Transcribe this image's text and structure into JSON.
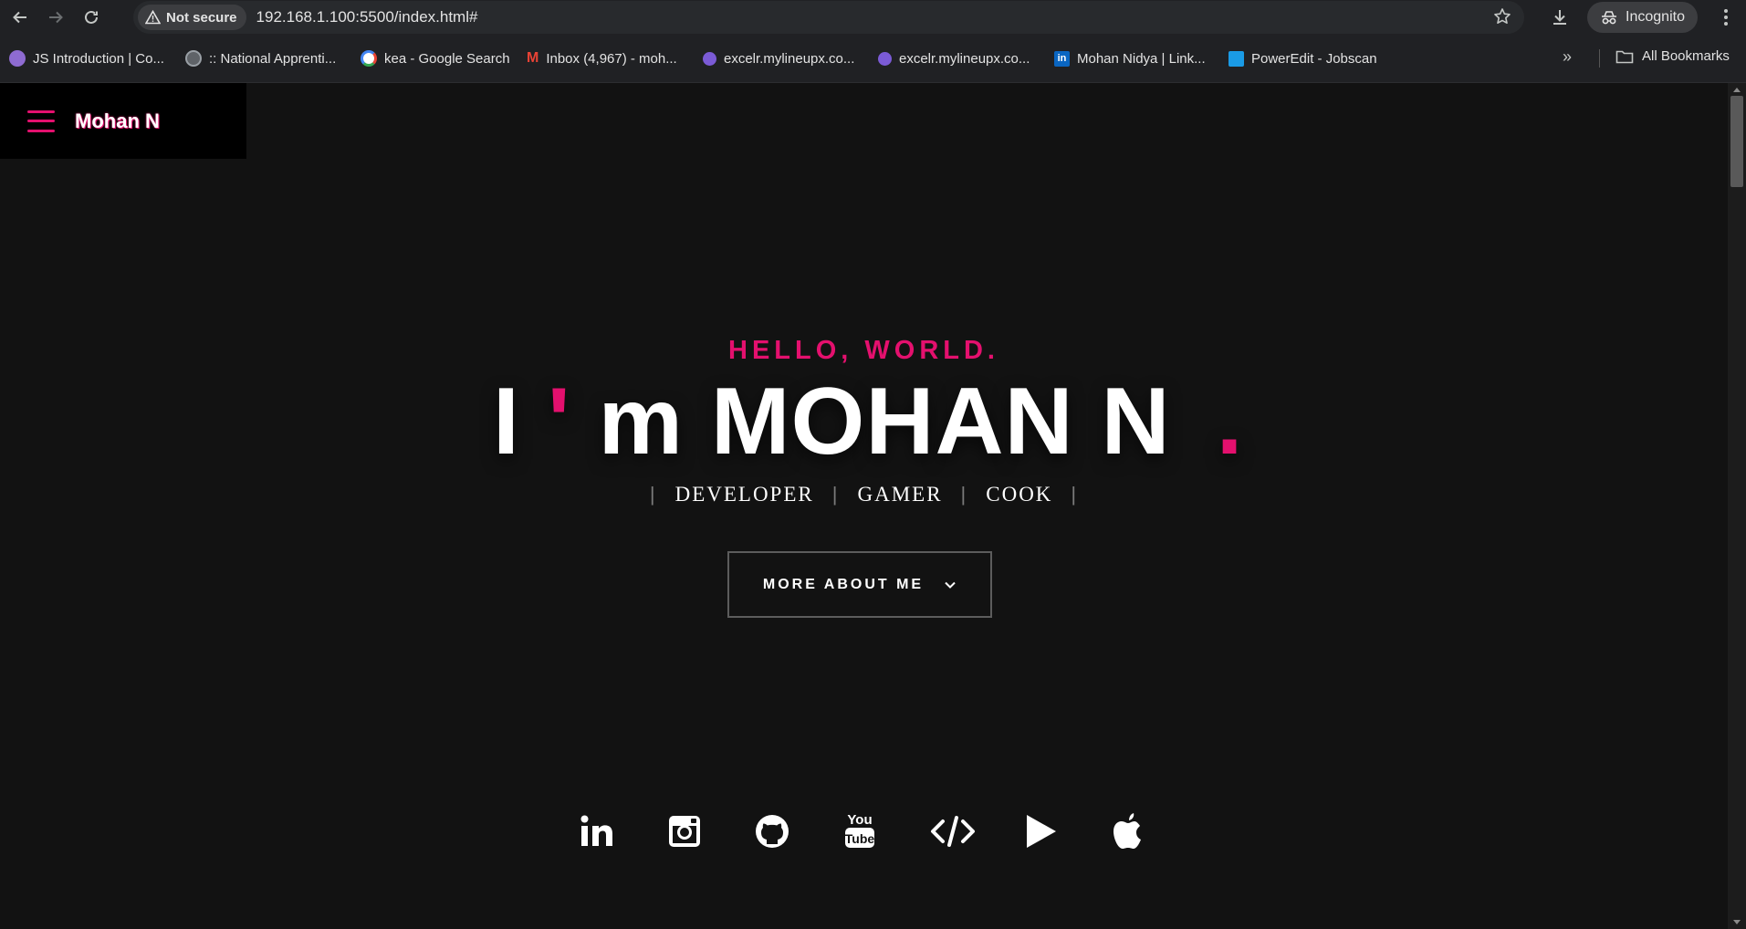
{
  "browser": {
    "security_label": "Not secure",
    "url": "192.168.1.100:5500/index.html#",
    "profile_label": "Incognito",
    "all_bookmarks_label": "All Bookmarks",
    "bookmarks": [
      {
        "label": "JS Introduction | Co...",
        "icon_color": "#8e6bd1"
      },
      {
        "label": ":: National Apprenti...",
        "icon_color": "#9aa0a6"
      },
      {
        "label": "kea - Google Search",
        "icon_color": "#4285f4"
      },
      {
        "label": "Inbox (4,967) - moh...",
        "icon_color": "#ea4335"
      },
      {
        "label": "excelr.mylineupx.co...",
        "icon_color": "#7b5bd6"
      },
      {
        "label": "excelr.mylineupx.co...",
        "icon_color": "#7b5bd6"
      },
      {
        "label": "Mohan Nidya | Link...",
        "icon_color": "#0a66c2"
      },
      {
        "label": "PowerEdit - Jobscan",
        "icon_color": "#1a9be6"
      }
    ]
  },
  "page": {
    "brand": "Mohan N",
    "greeting": "HELLO, WORLD.",
    "headline": {
      "part1": "I",
      "apostrophe": "'",
      "part2": "m MOHAN N",
      "dot": "."
    },
    "roles": [
      "DEVELOPER",
      "GAMER",
      "COOK"
    ],
    "cta_label": "MORE ABOUT ME",
    "socials": [
      "linkedin-icon",
      "instagram-icon",
      "github-icon",
      "youtube-icon",
      "code-icon",
      "play-icon",
      "apple-icon"
    ]
  },
  "colors": {
    "accent": "#e4106e",
    "background": "#121212",
    "text": "#ffffff"
  }
}
